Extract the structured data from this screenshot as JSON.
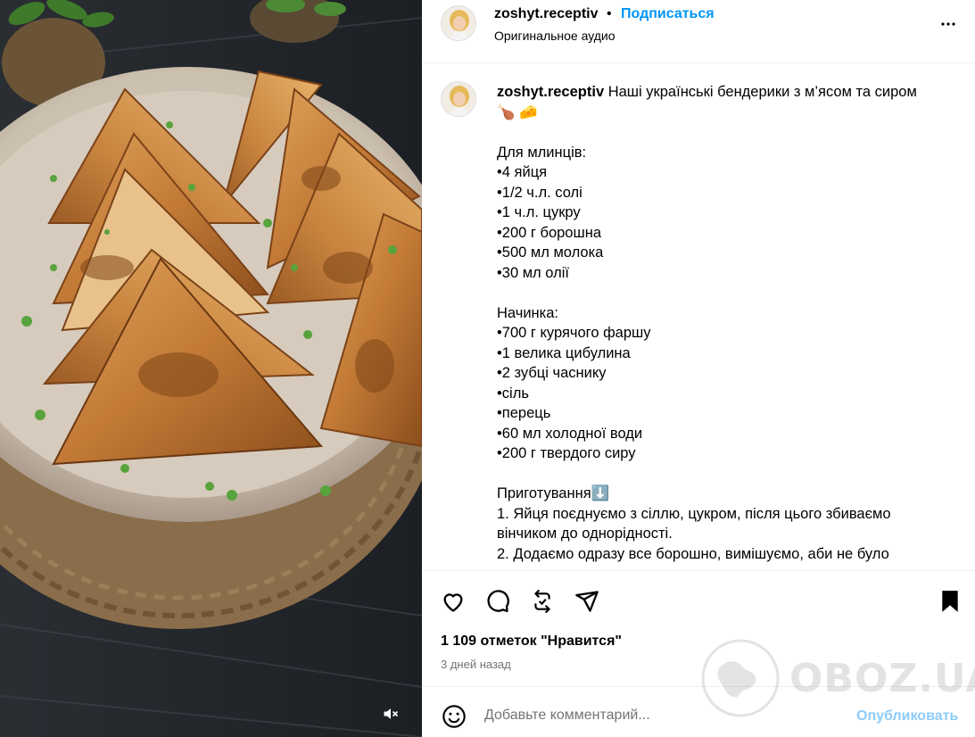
{
  "post": {
    "username": "zoshyt.receptiv",
    "separator": "•",
    "follow_label": "Подписаться",
    "audio_label": "Оригинальное аудио",
    "more_icon": "more-horizontal-icon"
  },
  "caption": {
    "username": "zoshyt.receptiv",
    "intro": " Наші українські бендерики з м’ясом та сиром",
    "intro_emoji": "🍗 🧀",
    "lines": [
      "",
      "Для млинців:",
      "•4 яйця",
      "•1/2 ч.л. солі",
      "•1 ч.л. цукру",
      "•200 г борошна",
      "•500 мл молока",
      "•30 мл олії",
      "",
      "Начинка:",
      "•700 г курячого фаршу",
      "•1 велика цибулина",
      "•2 зубці часнику",
      "•сіль",
      "•перець",
      "•60 мл холодної води",
      "•200 г твердого сиру",
      "",
      "Приготування⬇️",
      "1. Яйця поєднуємо з сіллю, цукром, після цього збиваємо вінчиком до однорідності.",
      "2. Додаємо одразу все борошно, вимішуємо, аби не було"
    ]
  },
  "actions": {
    "likes": "1 109 отметок \"Нравится\"",
    "time": "3 дней назад"
  },
  "comment": {
    "placeholder": "Добавьте комментарий...",
    "post_label": "Опубликовать"
  },
  "watermark": {
    "text": "OBOZ.UA"
  },
  "colors": {
    "accent": "#0095f6",
    "post_disabled": "#8ecbf9",
    "secondary_text": "#737373",
    "divider": "#efefef"
  }
}
